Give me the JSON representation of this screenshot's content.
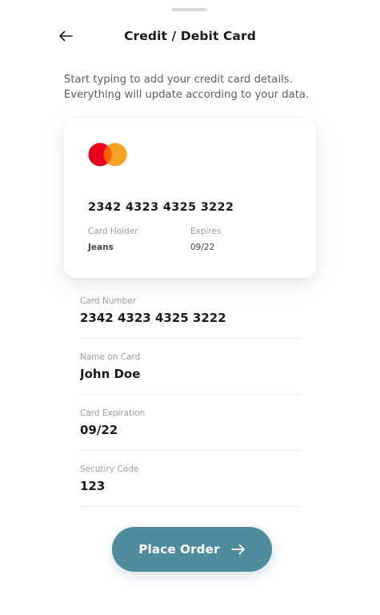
{
  "header": {
    "title": "Credit / Debit Card",
    "back_icon": "arrow-left-icon"
  },
  "instructions": {
    "line1": "Start typing to add your credit card details.",
    "line2": "Everything will update according to your data."
  },
  "card_preview": {
    "brand_icon": "mastercard-logo-icon",
    "brand_colors": {
      "left": "#eb001b",
      "right": "#f79e1b"
    },
    "number": "2342 4323 4325 3222",
    "holder_label": "Card Holder",
    "holder_value": "Jeans",
    "expires_label": "Expires",
    "expires_value": "09/22"
  },
  "form": {
    "card_number": {
      "label": "Card Number",
      "value": "2342 4323 4325 3222"
    },
    "name_on_card": {
      "label": "Name on Card",
      "value": "John Doe"
    },
    "card_expiration": {
      "label": "Card Expiration",
      "value": "09/22"
    },
    "security_code": {
      "label": "Secutiry Code",
      "value": "123"
    }
  },
  "place_order": {
    "label": "Place Order",
    "icon": "arrow-right-icon",
    "color": "#4f8d9e"
  }
}
